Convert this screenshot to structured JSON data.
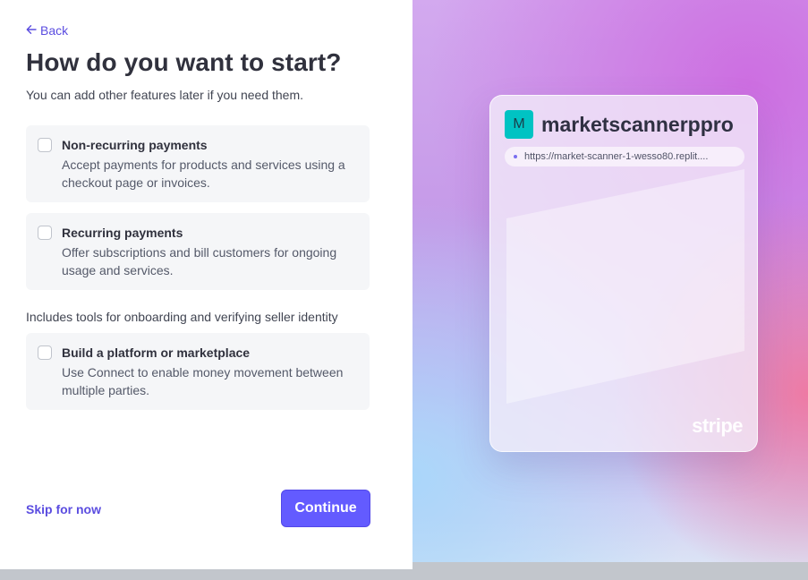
{
  "nav": {
    "back_label": "Back"
  },
  "heading": {
    "title": "How do you want to start?",
    "subtitle": "You can add other features later if you need them."
  },
  "options": [
    {
      "title": "Non-recurring payments",
      "description": "Accept payments for products and services using a checkout page or invoices.",
      "checked": false
    },
    {
      "title": "Recurring payments",
      "description": "Offer subscriptions and bill customers for ongoing usage and services.",
      "checked": false
    },
    {
      "title": "Build a platform or marketplace",
      "description": "Use Connect to enable money movement between multiple parties.",
      "checked": false
    }
  ],
  "section_note": "Includes tools for onboarding and verifying seller identity",
  "footer": {
    "skip_label": "Skip for now",
    "continue_label": "Continue"
  },
  "preview": {
    "avatar_letter": "M",
    "business_name": "marketscannerppro",
    "url": "https://market-scanner-1-wesso80.replit....",
    "brand": "stripe",
    "accent_color": "#635bff",
    "avatar_color": "#00c3c3"
  }
}
